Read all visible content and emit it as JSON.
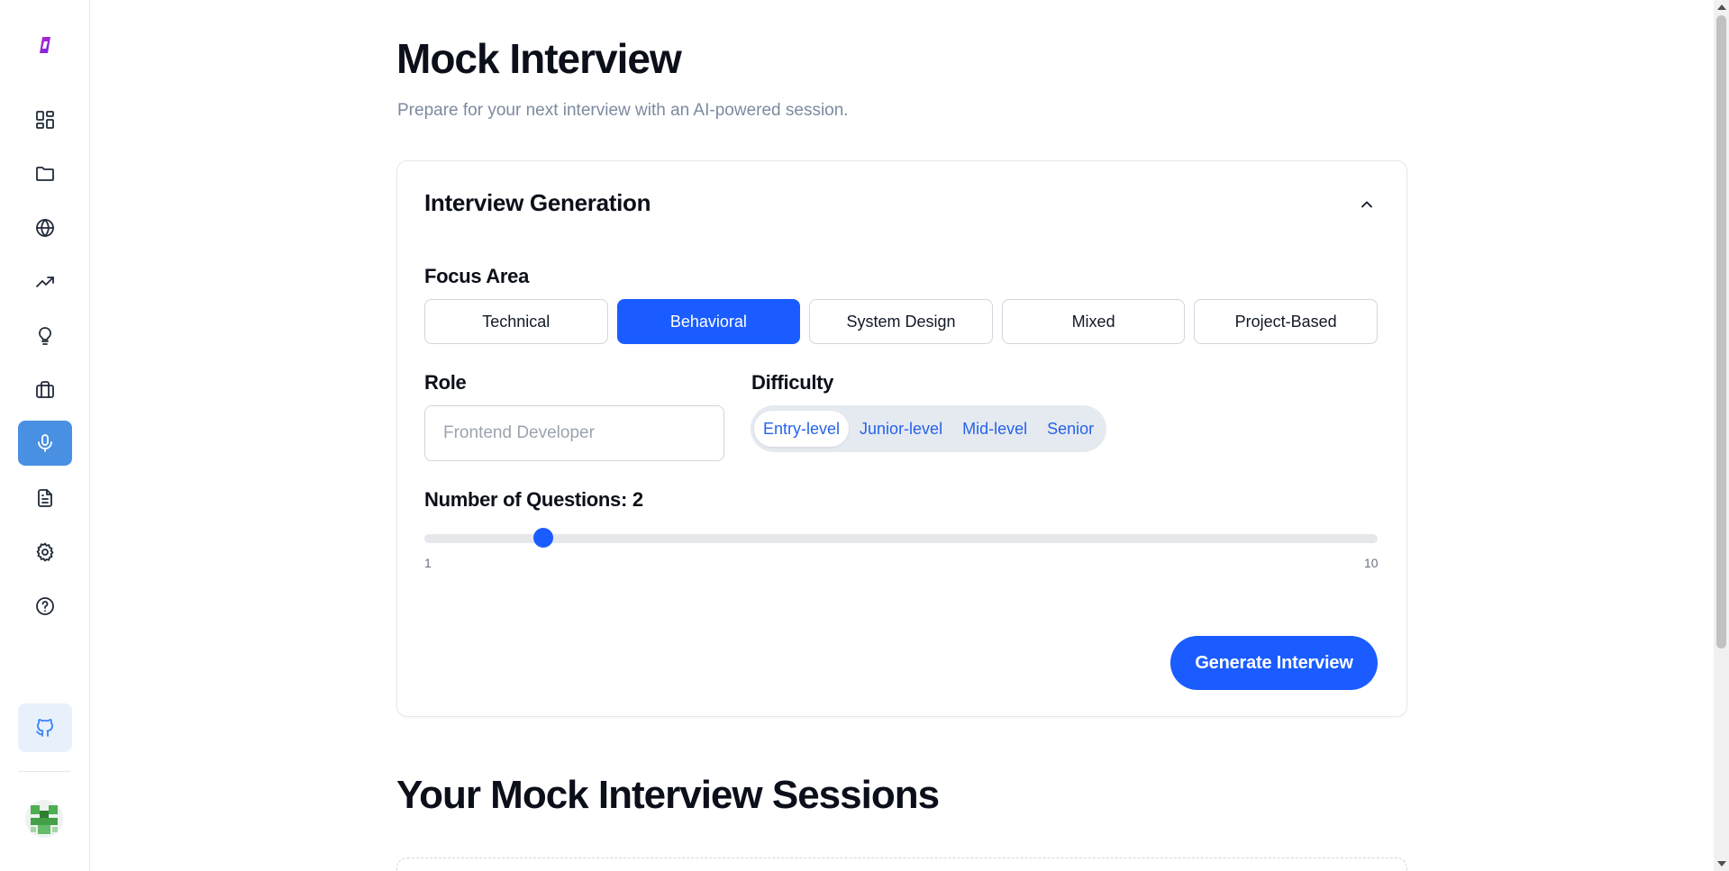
{
  "page": {
    "title": "Mock Interview",
    "subtitle": "Prepare for your next interview with an AI-powered session."
  },
  "sidebar": {
    "items": [
      {
        "icon": "dashboard-icon",
        "active": false
      },
      {
        "icon": "folder-icon",
        "active": false
      },
      {
        "icon": "globe-icon",
        "active": false
      },
      {
        "icon": "trending-up-icon",
        "active": false
      },
      {
        "icon": "lightbulb-icon",
        "active": false
      },
      {
        "icon": "briefcase-icon",
        "active": false
      },
      {
        "icon": "microphone-icon",
        "active": true
      },
      {
        "icon": "document-icon",
        "active": false
      },
      {
        "icon": "gear-icon",
        "active": false
      },
      {
        "icon": "help-circle-icon",
        "active": false
      }
    ],
    "github_icon": "github-icon",
    "accent_color": "#4a90e2"
  },
  "generation": {
    "title": "Interview Generation",
    "focus_label": "Focus Area",
    "focus_options": [
      "Technical",
      "Behavioral",
      "System Design",
      "Mixed",
      "Project-Based"
    ],
    "focus_selected": "Behavioral",
    "role_label": "Role",
    "role_value": "",
    "role_placeholder": "Frontend Developer",
    "difficulty_label": "Difficulty",
    "difficulty_options": [
      "Entry-level",
      "Junior-level",
      "Mid-level",
      "Senior"
    ],
    "difficulty_selected": "Entry-level",
    "questions_label": "Number of Questions: 2",
    "questions_value": 2,
    "questions_min": "1",
    "questions_max": "10",
    "generate_label": "Generate Interview",
    "primary_color": "#1a5cff"
  },
  "sessions": {
    "title": "Your Mock Interview Sessions"
  }
}
